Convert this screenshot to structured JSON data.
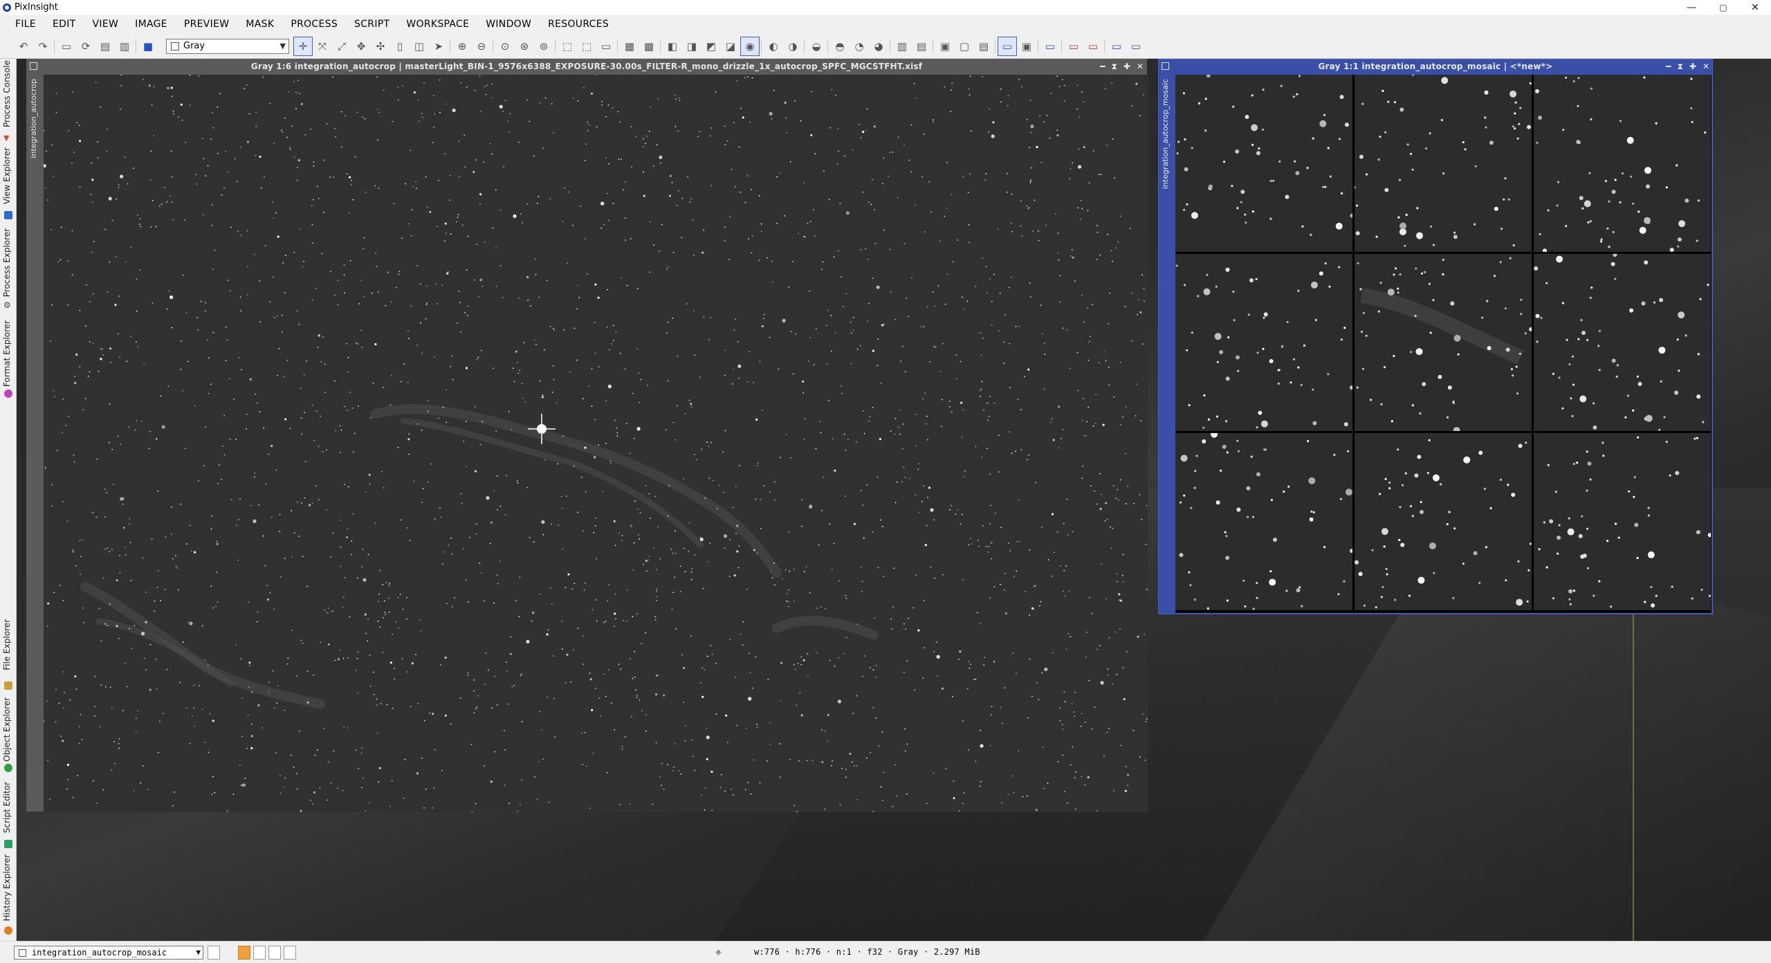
{
  "app": {
    "title": "PixInsight"
  },
  "window_controls": {
    "minimize": "—",
    "maximize": "▢",
    "close": "✕"
  },
  "menu": [
    "FILE",
    "EDIT",
    "VIEW",
    "IMAGE",
    "PREVIEW",
    "MASK",
    "PROCESS",
    "SCRIPT",
    "WORKSPACE",
    "WINDOW",
    "RESOURCES"
  ],
  "toolbar": {
    "colorspace": "Gray"
  },
  "left_dock": [
    {
      "label": "Process Console",
      "color": "#d94c2a"
    },
    {
      "label": "View Explorer",
      "color": "#2f6ad0"
    },
    {
      "label": "Process Explorer",
      "color": "#444444"
    },
    {
      "label": "Format Explorer",
      "color": "#c040c0"
    },
    {
      "label": "File Explorer",
      "color": "#c8a040"
    },
    {
      "label": "Object Explorer",
      "color": "#30a040"
    },
    {
      "label": "Script Editor",
      "color": "#2aa060"
    },
    {
      "label": "History Explorer",
      "color": "#e08020"
    }
  ],
  "windows": [
    {
      "title": "Gray 1:6 integration_autocrop | masterLight_BIN-1_9576x6388_EXPOSURE-30.00s_FILTER-R_mono_drizzle_1x_autocrop_SPFC_MGCSTFHT.xisf",
      "side_label": "integration_autocrop"
    },
    {
      "title": "Gray 1:1 integration_autocrop_mosaic | <*new*>",
      "side_label": "integration_autocrop_mosaic"
    }
  ],
  "statusbar": {
    "view": "integration_autocrop_mosaic",
    "info": "w:776 · h:776 · n:1 · f32 · Gray · 2.297 MiB"
  },
  "colors": {
    "accent": "#3a4fa8",
    "background": "#2a2a2a"
  }
}
